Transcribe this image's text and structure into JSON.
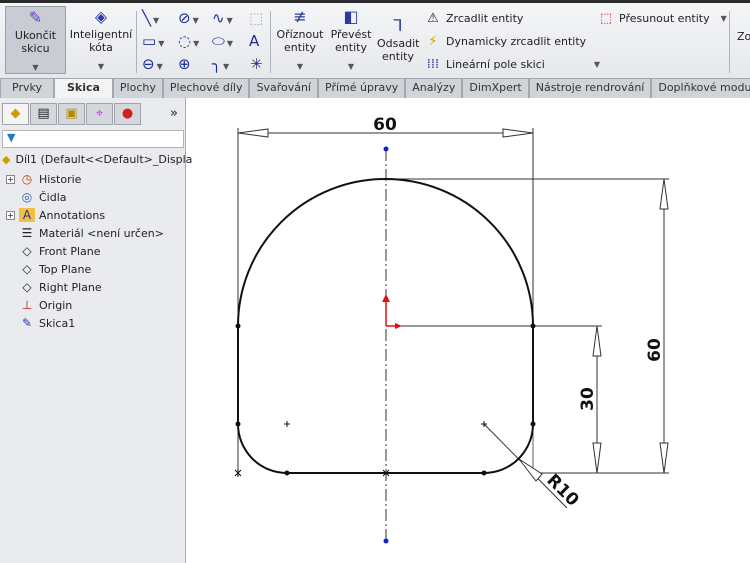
{
  "toolbar": {
    "exit_sketch": "Ukončit skicu",
    "smart_dimension": "Inteligentní kóta",
    "trim": "Oříznout entity",
    "convert": "Převést entity",
    "offset": "Odsadit entity",
    "mirror": "Zrcadlit entity",
    "dynamic_mirror": "Dynamicky zrcadlit entity",
    "linear_pattern": "Lineární pole skici",
    "move": "Přesunout entity",
    "cut_off": "Zo"
  },
  "tabs": [
    "Prvky",
    "Skica",
    "Plochy",
    "Plechové díly",
    "Svařování",
    "Přímé úpravy",
    "Analýzy",
    "DimXpert",
    "Nástroje rendrování",
    "Doplňkové moduly"
  ],
  "active_tab": "Skica",
  "tree": {
    "root": "Díl1  (Default<<Default>_Displa",
    "items": [
      "Historie",
      "Čidla",
      "Annotations",
      "Materiál <není určen>",
      "Front Plane",
      "Top Plane",
      "Right Plane",
      "Origin",
      "Skica1"
    ]
  },
  "sketch": {
    "width_dim": "60",
    "height_dim": "60",
    "mid_dim": "30",
    "radius_dim": "R10"
  }
}
